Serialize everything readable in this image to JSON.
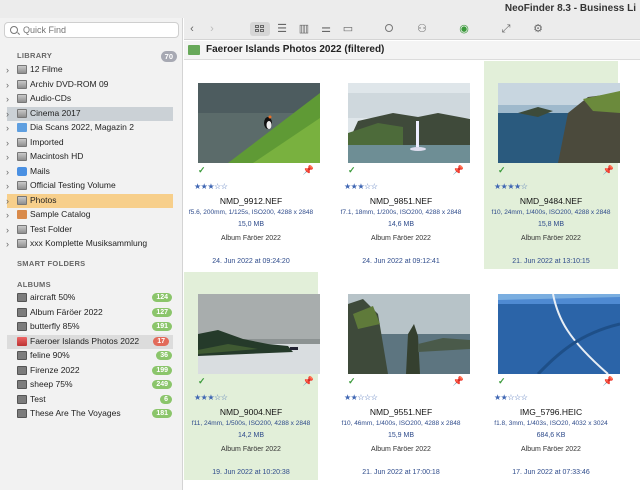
{
  "app": {
    "title": "NeoFinder 8.3 - Business Li"
  },
  "search": {
    "placeholder": "Quick Find"
  },
  "sidebar": {
    "library_title": "LIBRARY",
    "library_count": "70",
    "library_items": [
      {
        "label": "12 Filme",
        "icon": "drive-icon",
        "state": ""
      },
      {
        "label": "Archiv DVD-ROM 09",
        "icon": "drive-icon",
        "state": ""
      },
      {
        "label": "Audio-CDs",
        "icon": "drive-icon",
        "state": ""
      },
      {
        "label": "Cinema 2017",
        "icon": "drive-icon",
        "state": "selected"
      },
      {
        "label": "Dia Scans 2022, Magazin 2",
        "icon": "folder-icon",
        "state": ""
      },
      {
        "label": "Imported",
        "icon": "drive-icon",
        "state": ""
      },
      {
        "label": "Macintosh HD",
        "icon": "drive-icon",
        "state": ""
      },
      {
        "label": "Mails",
        "icon": "mail-icon",
        "state": ""
      },
      {
        "label": "Official Testing Volume",
        "icon": "drive-icon",
        "state": ""
      },
      {
        "label": "Photos",
        "icon": "drive-icon",
        "state": "selected-orange"
      },
      {
        "label": "Sample Catalog",
        "icon": "catalog-icon",
        "state": ""
      },
      {
        "label": "Test Folder",
        "icon": "drive-icon",
        "state": ""
      },
      {
        "label": "xxx Komplette Musiksammlung",
        "icon": "drive-icon",
        "state": ""
      }
    ],
    "smart_folders_title": "SMART FOLDERS",
    "albums_title": "ALBUMS",
    "albums": [
      {
        "label": "aircraft 50%",
        "count": "124"
      },
      {
        "label": "Album Färöer 2022",
        "count": "127"
      },
      {
        "label": "butterfly 85%",
        "count": "191"
      },
      {
        "label": "Faeroer Islands Photos 2022",
        "count": "17",
        "state": "selected-album"
      },
      {
        "label": "feline 90%",
        "count": "36"
      },
      {
        "label": "Firenze 2022",
        "count": "199"
      },
      {
        "label": "sheep 75%",
        "count": "249"
      },
      {
        "label": "Test",
        "count": "6"
      },
      {
        "label": "These Are The Voyages",
        "count": "181"
      }
    ]
  },
  "header": {
    "title": "Faeroer Islands Photos 2022  (filtered)"
  },
  "photos": [
    {
      "name": "NMD_9912.NEF",
      "meta": "f5.6, 200mm, 1/125s, ISO200, 4288 x 2848",
      "size": "15,0 MB",
      "album": "Album Färöer 2022",
      "date": "24. Jun 2022 at 09:24:20",
      "rating": 3,
      "stars": "★★★☆☆",
      "highlight": false,
      "scene": "puffin"
    },
    {
      "name": "NMD_9851.NEF",
      "meta": "f7.1, 18mm, 1/200s, ISO200, 4288 x 2848",
      "size": "14,6 MB",
      "album": "Album Färöer 2022",
      "date": "24. Jun 2022 at 09:12:41",
      "rating": 3,
      "stars": "★★★☆☆",
      "highlight": false,
      "scene": "waterfall"
    },
    {
      "name": "NMD_9484.NEF",
      "meta": "f10, 24mm, 1/400s, ISO200, 4288 x 2848",
      "size": "15,8 MB",
      "album": "Album Färöer 2022",
      "date": "21. Jun 2022 at 13:10:15",
      "rating": 4,
      "stars": "★★★★☆",
      "highlight": true,
      "scene": "cliffs"
    },
    {
      "name": "NMD_9004.NEF",
      "meta": "f11, 24mm, 1/500s, ISO200, 4288 x 2848",
      "size": "14,2 MB",
      "album": "Album Färöer 2022",
      "date": "19. Jun 2022 at 10:20:38",
      "rating": 3,
      "stars": "★★★☆☆",
      "highlight": true,
      "scene": "coast"
    },
    {
      "name": "NMD_9551.NEF",
      "meta": "f10, 46mm, 1/400s, ISO200, 4288 x 2848",
      "size": "15,9 MB",
      "album": "Album Färöer 2022",
      "date": "21. Jun 2022 at 17:00:18",
      "rating": 2,
      "stars": "★★☆☆☆",
      "highlight": false,
      "scene": "seastack"
    },
    {
      "name": "IMG_5796.HEIC",
      "meta": "f1.8, 3mm, 1/403s, ISO20, 4032 x 3024",
      "size": "684,6 KB",
      "album": "Album Färöer 2022",
      "date": "17. Jun 2022 at 07:33:46",
      "rating": 2,
      "stars": "★★☆☆☆",
      "highlight": false,
      "scene": "aerial"
    }
  ],
  "colors": {
    "accent_green": "#8bc56b",
    "star_blue": "#3f66b3",
    "selection_orange": "#f7cf8b"
  }
}
